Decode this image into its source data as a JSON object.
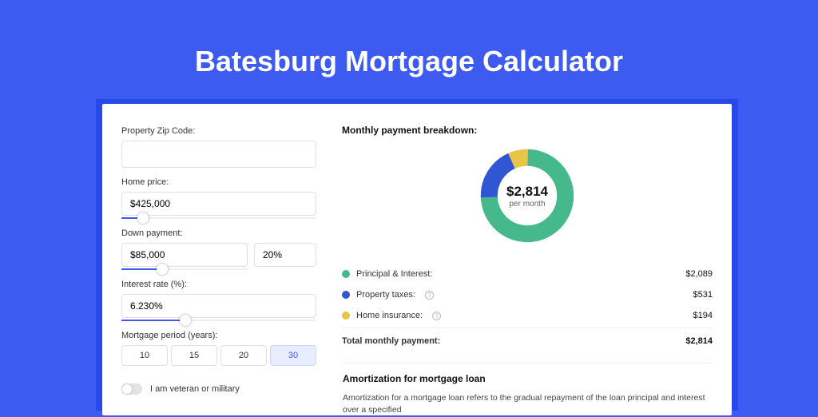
{
  "title": "Batesburg Mortgage Calculator",
  "form": {
    "zip_label": "Property Zip Code:",
    "zip_value": "",
    "home_label": "Home price:",
    "home_value": "$425,000",
    "down_label": "Down payment:",
    "down_amount": "$85,000",
    "down_pct": "20%",
    "rate_label": "Interest rate (%):",
    "rate_value": "6.230%",
    "period_label": "Mortgage period (years):",
    "period_options": [
      "10",
      "15",
      "20",
      "30"
    ],
    "period_selected": "30",
    "veteran_label": "I am veteran or military"
  },
  "breakdown": {
    "title": "Monthly payment breakdown:",
    "center_amount": "$2,814",
    "center_sub": "per month",
    "items": [
      {
        "label": "Principal & Interest:",
        "value": "$2,089",
        "color": "green"
      },
      {
        "label": "Property taxes:",
        "value": "$531",
        "color": "blue",
        "info": true
      },
      {
        "label": "Home insurance:",
        "value": "$194",
        "color": "yellow",
        "info": true
      }
    ],
    "total_label": "Total monthly payment:",
    "total_value": "$2,814"
  },
  "amort": {
    "title": "Amortization for mortgage loan",
    "text": "Amortization for a mortgage loan refers to the gradual repayment of the loan principal and interest over a specified"
  },
  "chart_data": {
    "type": "pie",
    "title": "Monthly payment breakdown",
    "series": [
      {
        "name": "Principal & Interest",
        "value": 2089,
        "color": "#46b98c"
      },
      {
        "name": "Property taxes",
        "value": 531,
        "color": "#3056d3"
      },
      {
        "name": "Home insurance",
        "value": 194,
        "color": "#e8c547"
      }
    ],
    "total": 2814,
    "unit": "USD per month"
  }
}
